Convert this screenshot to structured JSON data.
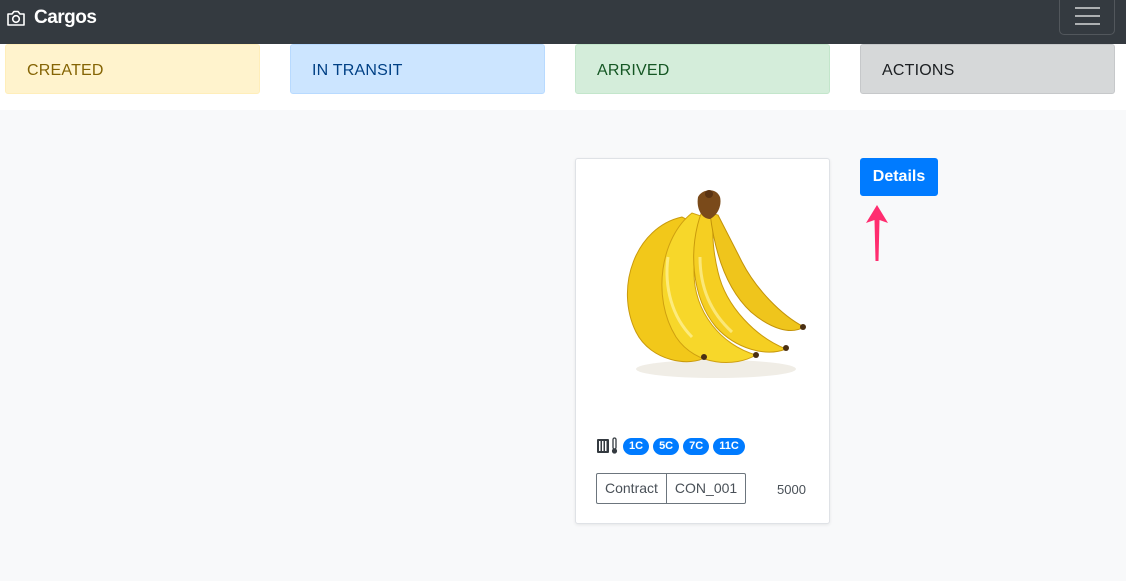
{
  "navbar": {
    "brand": "Cargos",
    "brand_icon": "camera-icon",
    "toggler_icon": "hamburger-icon"
  },
  "statuses": [
    {
      "label": "CREATED",
      "color": "#fff3cd"
    },
    {
      "label": "IN TRANSIT",
      "color": "#cce5ff"
    },
    {
      "label": "ARRIVED",
      "color": "#d4edda"
    },
    {
      "label": "ACTIONS",
      "color": "#d6d8d9"
    }
  ],
  "cargo": {
    "image": "banana-image",
    "sensor_icon": "temperature-sensor-icon",
    "temperatures": [
      "1C",
      "5C",
      "7C",
      "11C"
    ],
    "contract_label": "Contract",
    "contract_id": "CON_001",
    "amount": "5000"
  },
  "actions": {
    "details_label": "Details",
    "accent": "#007bff",
    "arrow_color": "#ff2d6f"
  }
}
